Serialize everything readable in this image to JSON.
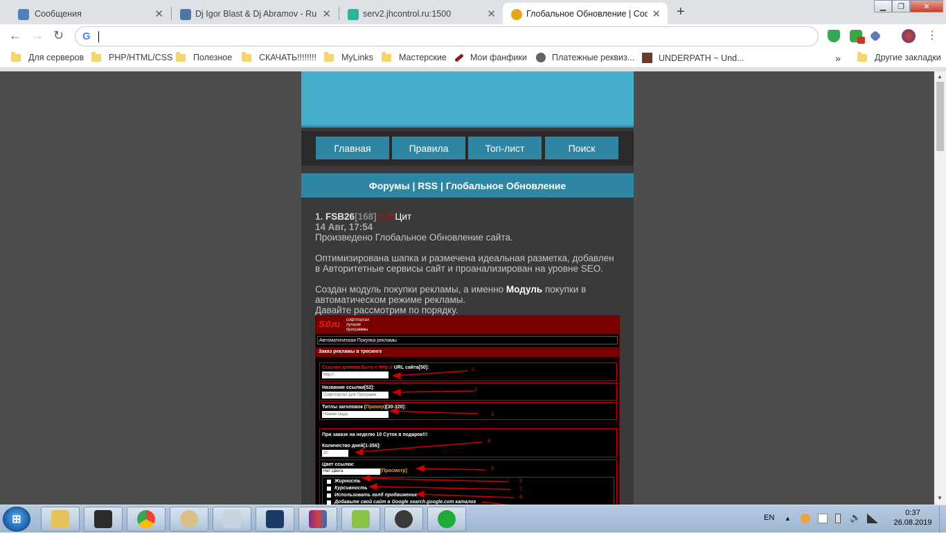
{
  "browser": {
    "tabs": [
      {
        "title": "Сообщения",
        "favicon": "chat-icon",
        "color": "#5181b8"
      },
      {
        "title": "Dj Igor Blast & Dj Abramov - Rus",
        "favicon": "vk-icon",
        "color": "#4a76a8"
      },
      {
        "title": "serv2.jhcontrol.ru:1500",
        "favicon": "panel-icon",
        "color": "#2bb3a0"
      },
      {
        "title": "Глобальное Обновление | Софт",
        "favicon": "soft-star-icon",
        "color": "#e8a317"
      }
    ],
    "new_tab": "+",
    "address_value": "",
    "bookmarks": [
      {
        "label": "Для серверов",
        "icon": "folder-icon"
      },
      {
        "label": "PHP/HTML/CSS",
        "icon": "folder-icon"
      },
      {
        "label": "Полезное",
        "icon": "folder-icon"
      },
      {
        "label": "СКАЧАТЬ!!!!!!!!",
        "icon": "folder-icon"
      },
      {
        "label": "MyLinks",
        "icon": "folder-icon"
      },
      {
        "label": "Мастерские",
        "icon": "folder-icon"
      },
      {
        "label": "Мои фанфики",
        "icon": "quill-icon"
      },
      {
        "label": "Платежные реквиз...",
        "icon": "globe-icon"
      },
      {
        "label": "UNDERPATH ~ Und...",
        "icon": "image-icon"
      }
    ],
    "bookmarks_overflow": "»",
    "other_bookmarks": "Другие закладки"
  },
  "site": {
    "nav": [
      "Главная",
      "Правила",
      "Топ-лист",
      "Поиск"
    ],
    "breadcrumb": "Форумы | RSS | Глобальное Обновление",
    "post": {
      "number": "1.",
      "author": "FSB26",
      "rep": "[168]",
      "status": "(Off)",
      "cite": "Цит",
      "date": "14 Авг, 17:54",
      "p1": "Произведено Глобальное Обновление сайта.",
      "p2": "Оптимизирована шапка и размечена идеальная разметка, добавлен в Авторитетные сервисы сайт и проанализирован на уровне SEO.",
      "p3_a": "Создан модуль покупки рекламы, а именно ",
      "p3_b": "Модуль",
      "p3_c": " покупки в автоматическом режиме рекламы.",
      "p4": "Давайте рассмотрим по порядку."
    },
    "form_shot": {
      "logo": "S.0.ru",
      "logo_sub": "софтпортал\nлучшие\nпрограммы",
      "bar1": "Автоматическая Покупка рекламы",
      "bar2": "Заказ рекламы в тресинге",
      "f1_label_a": "Ссылка должна быть с http:// ",
      "f1_label_b": "URL сайта[50]:",
      "f1_value": "http://",
      "f2_label": "Название ссылки[52]:",
      "f2_value": "Софтпортал для Программ",
      "f3_label_a": "Титлы заголовок (",
      "f3_label_b": "Пример",
      "f3_label_c": ")[30-320]:",
      "f3_value": "Нажми сюда",
      "promo": "При заказе на неделю 10 Суток в подарок!!!",
      "days_label": "Количество дней[1-356]:",
      "days_value": "20",
      "color_label": "Цвет ссылки:",
      "color_value": "Нет Цвета",
      "preview": "[Просмотр]",
      "checks": [
        "Жирность",
        "Курсивность",
        "Использовать голд продвижение",
        "Добавьте свой сайт в Google search.google.com каталог"
      ],
      "notes": [
        "1.",
        "2.",
        "3.",
        "4.",
        "5.",
        "6.",
        "7.",
        "8."
      ]
    }
  },
  "taskbar": {
    "apps": [
      "explorer-icon",
      "terminal-icon",
      "chrome-icon",
      "paint-icon",
      "calculator-icon",
      "photoshop-icon",
      "winrar-icon",
      "notepadpp-icon",
      "obs-icon",
      "player-icon"
    ],
    "lang": "EN",
    "time": "0:37",
    "date": "26.08.2019"
  }
}
